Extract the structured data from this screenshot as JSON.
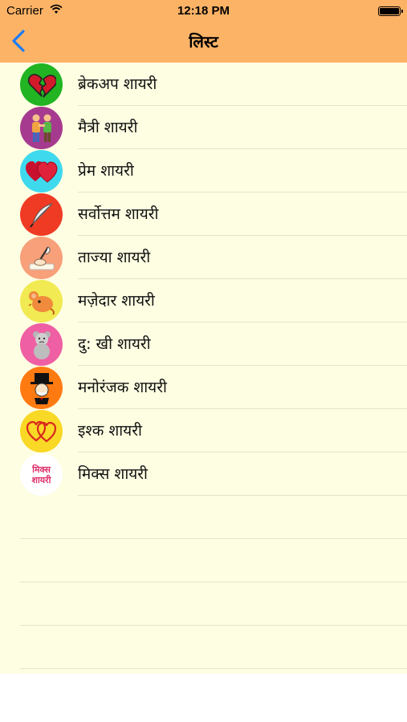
{
  "status_bar": {
    "carrier": "Carrier",
    "time": "12:18 PM"
  },
  "nav": {
    "title": "लिस्ट",
    "back_icon": "chevron-left-icon"
  },
  "colors": {
    "header": "#fdb366",
    "list_bg": "#fefee2",
    "back": "#1a7cf5"
  },
  "items": [
    {
      "label": "ब्रेकअप शायरी",
      "icon": "broken-heart-icon",
      "color": "#22b422"
    },
    {
      "label": "मैत्री शायरी",
      "icon": "friends-icon",
      "color": "#a63a8f"
    },
    {
      "label": "प्रेम शायरी",
      "icon": "hearts-icon",
      "color": "#3fd9ee"
    },
    {
      "label": "सर्वोत्तम शायरी",
      "icon": "quill-icon",
      "color": "#ef3b24"
    },
    {
      "label": "ताज्या शायरी",
      "icon": "writing-hand-icon",
      "color": "#f7a07a"
    },
    {
      "label": "मज़ेदार शायरी",
      "icon": "funny-mouse-icon",
      "color": "#f1ea52"
    },
    {
      "label": "दु: खी शायरी",
      "icon": "sad-teddy-icon",
      "color": "#ef5fa3"
    },
    {
      "label": "मनोरंजक शायरी",
      "icon": "entertainer-icon",
      "color": "#ff7b12"
    },
    {
      "label": "इश्क शायरी",
      "icon": "love-hearts-icon",
      "color": "#f9d826"
    },
    {
      "label": "मिक्स शायरी",
      "icon": "mix-text-icon",
      "color": "#ffffff",
      "icon_text": [
        "मिक्स",
        "शायरी"
      ]
    }
  ]
}
